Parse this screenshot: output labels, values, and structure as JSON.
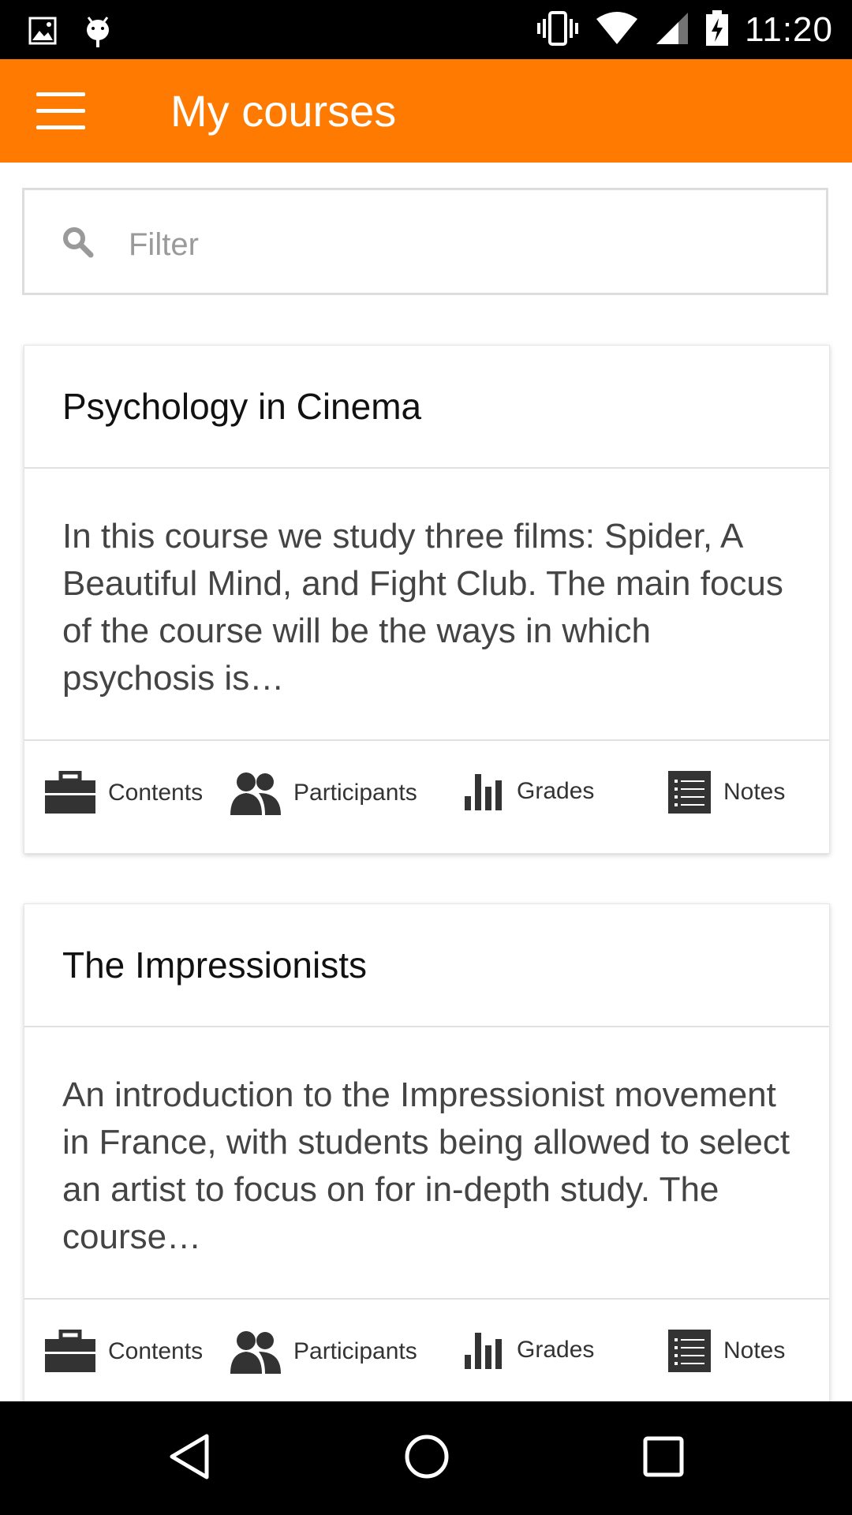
{
  "status_bar": {
    "time": "11:20",
    "icons": [
      "image-icon",
      "android-debug-icon",
      "vibrate-icon",
      "wifi-icon",
      "signal-icon",
      "battery-charging-icon"
    ]
  },
  "app_bar": {
    "title": "My courses",
    "menu_icon": "hamburger-menu-icon",
    "color": "#ff7a00"
  },
  "filter": {
    "placeholder": "Filter",
    "value": ""
  },
  "courses": [
    {
      "title": "Psychology in Cinema",
      "summary": "In this course we study three films: Spider, A Beautiful Mind, and Fight Club. The main focus of the course will be the ways in which psychosis is…",
      "actions": {
        "contents": "Contents",
        "participants": "Participants",
        "grades": "Grades",
        "notes": "Notes"
      }
    },
    {
      "title": "The Impressionists",
      "summary": "An introduction to the Impressionist movement in France, with students being allowed to select an artist to focus on for in-depth study. The course…",
      "actions": {
        "contents": "Contents",
        "participants": "Participants",
        "grades": "Grades",
        "notes": "Notes"
      }
    }
  ],
  "nav_bar": {
    "icons": [
      "back-icon",
      "home-icon",
      "recents-icon"
    ]
  }
}
